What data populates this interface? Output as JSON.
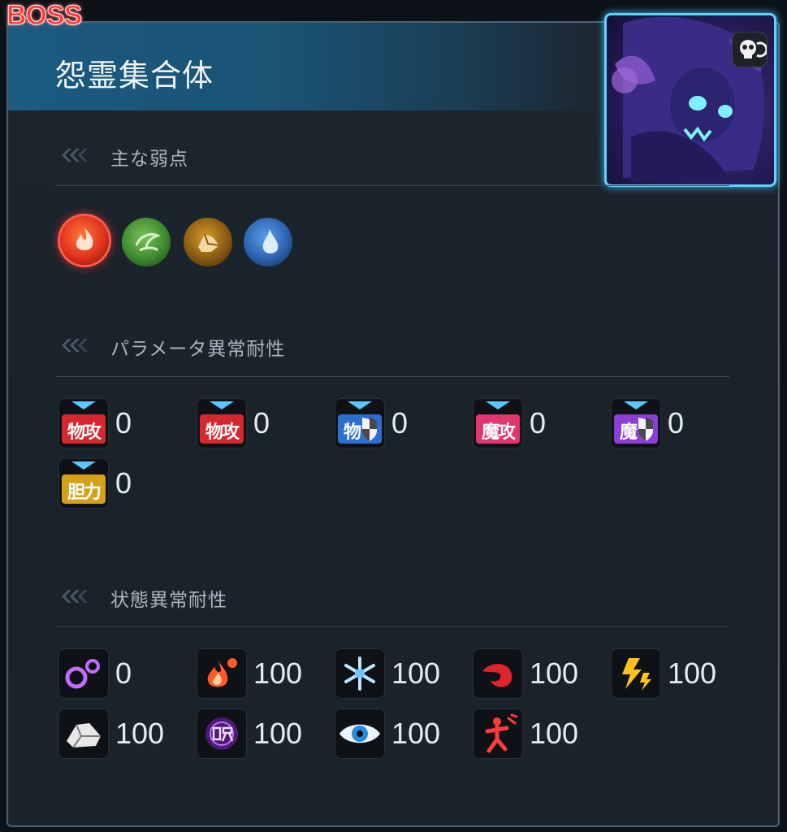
{
  "boss_tag": "BOSS",
  "boss_name": "怨霊集合体",
  "sections": {
    "weakness_title": "主な弱点",
    "param_title": "パラメータ異常耐性",
    "status_title": "状態異常耐性"
  },
  "weaknesses": [
    {
      "icon": "fire-element-icon",
      "color": "#e83a22",
      "highlighted": true
    },
    {
      "icon": "wind-element-icon",
      "color": "#4a9a3a",
      "highlighted": false
    },
    {
      "icon": "earth-element-icon",
      "color": "#9a6a1a",
      "highlighted": false
    },
    {
      "icon": "water-element-icon",
      "color": "#2f6fb8",
      "highlighted": false
    }
  ],
  "param_resist": [
    {
      "icon": "phys-attack-down-icon",
      "label": "物攻",
      "value": "0"
    },
    {
      "icon": "phys-attack-down-icon",
      "label": "物攻",
      "value": "0"
    },
    {
      "icon": "phys-defense-down-icon",
      "label": "物",
      "value": "0"
    },
    {
      "icon": "mag-attack-down-icon",
      "label": "魔攻",
      "value": "0"
    },
    {
      "icon": "mag-defense-down-icon",
      "label": "魔",
      "value": "0"
    },
    {
      "icon": "courage-down-icon",
      "label": "胆力",
      "value": "0"
    }
  ],
  "status_resist": [
    {
      "icon": "slow-icon",
      "value": "0"
    },
    {
      "icon": "burn-icon",
      "value": "100"
    },
    {
      "icon": "freeze-icon",
      "value": "100"
    },
    {
      "icon": "bleed-icon",
      "value": "100"
    },
    {
      "icon": "shock-icon",
      "value": "100"
    },
    {
      "icon": "petrify-icon",
      "value": "100"
    },
    {
      "icon": "curse-icon",
      "value": "100"
    },
    {
      "icon": "blind-icon",
      "value": "100"
    },
    {
      "icon": "stun-icon",
      "value": "100"
    }
  ],
  "colors": {
    "accent": "#5ed4ff",
    "boss_red": "#ff3b3b",
    "phys": "#d5282e",
    "mag": "#e0356e",
    "phys_def": "#2d6fd0",
    "mag_def": "#8a3fd6",
    "courage": "#d3a21a"
  }
}
